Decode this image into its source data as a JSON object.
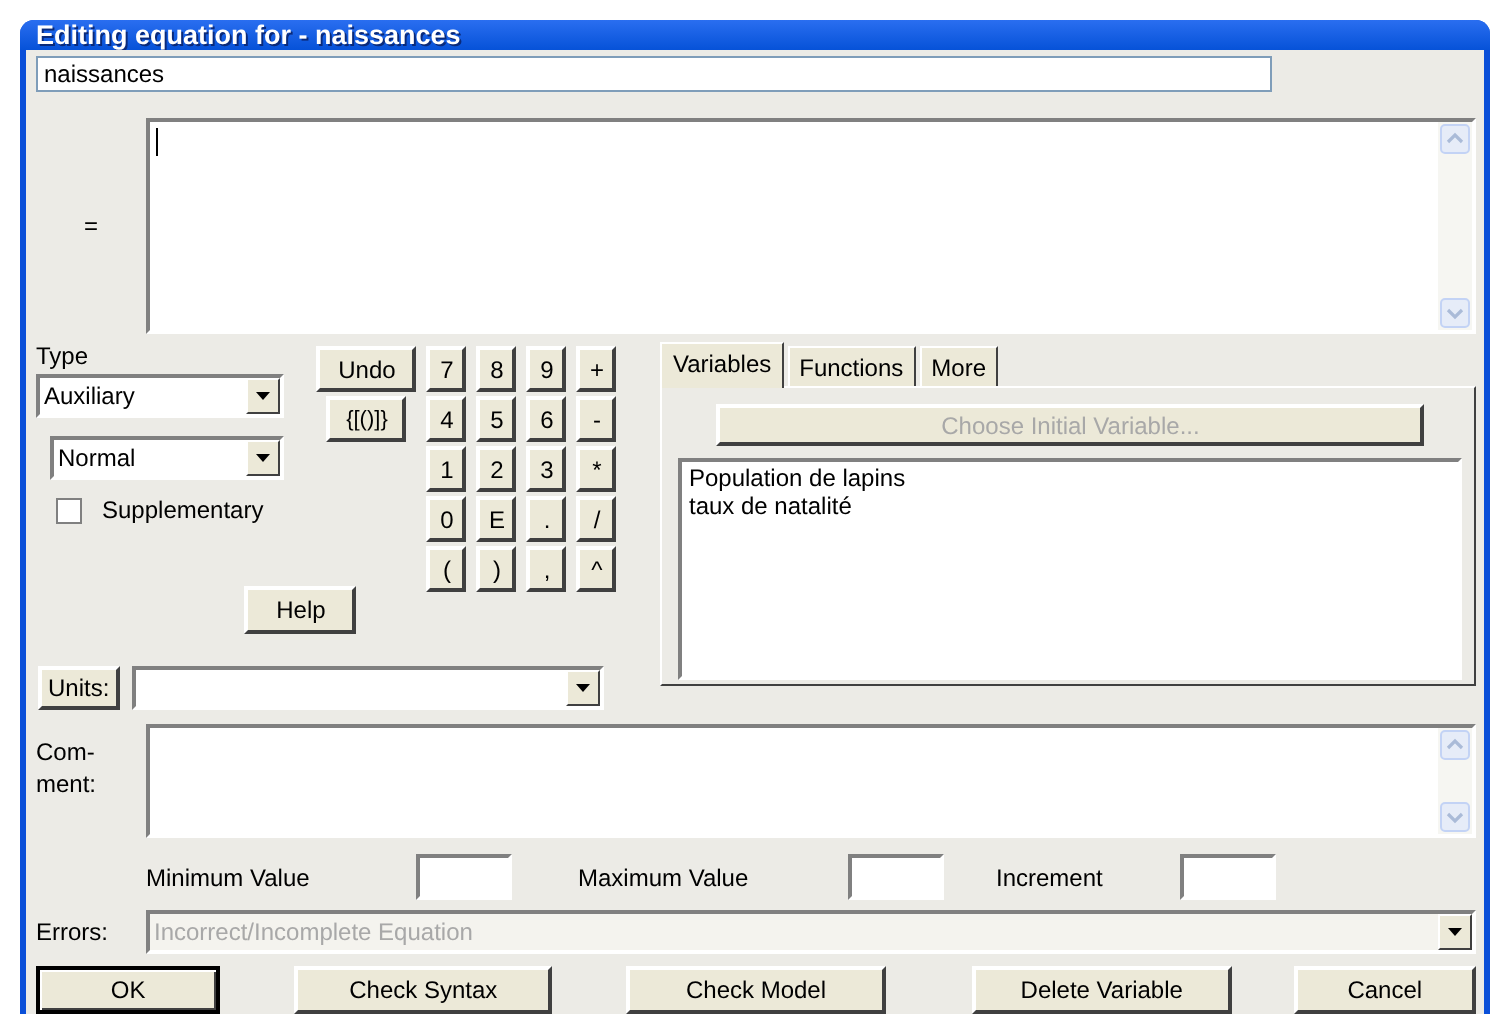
{
  "window": {
    "title": "Editing equation for - naissances"
  },
  "name_field": {
    "value": "naissances"
  },
  "equation": {
    "label": "="
  },
  "type": {
    "label": "Type",
    "selects": [
      {
        "value": "Auxiliary"
      },
      {
        "value": "Normal"
      }
    ],
    "supplementary": {
      "label": "Supplementary",
      "checked": false
    }
  },
  "keypad": {
    "side_keys": [
      "Undo",
      "{[()]}"
    ],
    "keys": [
      "7",
      "8",
      "9",
      "+",
      "4",
      "5",
      "6",
      "-",
      "1",
      "2",
      "3",
      "*",
      "0",
      "E",
      ".",
      "/",
      "(",
      ")",
      ",",
      "^"
    ]
  },
  "help_button": "Help",
  "tabs": [
    {
      "label": "Variables",
      "selected": true
    },
    {
      "label": "Functions",
      "selected": false
    },
    {
      "label": "More",
      "selected": false
    }
  ],
  "choose_button": {
    "label": "Choose Initial Variable...",
    "disabled": true
  },
  "variables": [
    "Population de lapins",
    "taux de natalité"
  ],
  "units": {
    "button": "Units:"
  },
  "comment": {
    "label": "Com-\nment:"
  },
  "ranges": [
    {
      "label": "Minimum Value"
    },
    {
      "label": "Maximum Value"
    },
    {
      "label": "Increment"
    }
  ],
  "errors": {
    "label": "Errors:",
    "value": "Incorrect/Incomplete Equation",
    "disabled": true
  },
  "buttons": [
    {
      "label": "OK",
      "default": true
    },
    {
      "label": "Check Syntax",
      "default": false
    },
    {
      "label": "Check Model",
      "default": false
    },
    {
      "label": "Delete Variable",
      "default": false
    },
    {
      "label": "Cancel",
      "default": false
    }
  ]
}
